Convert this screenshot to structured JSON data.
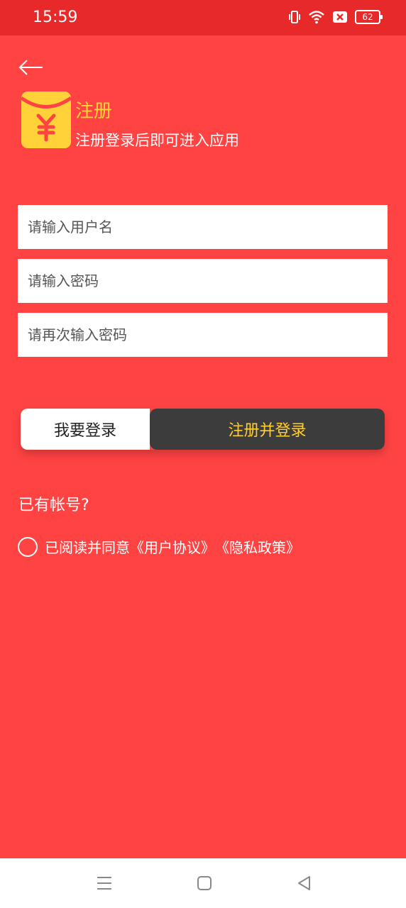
{
  "status": {
    "time": "15:59",
    "battery": "62"
  },
  "header": {
    "title": "注册",
    "subtitle": "注册登录后即可进入应用"
  },
  "form": {
    "username_placeholder": "请输入用户名",
    "password_placeholder": "请输入密码",
    "confirm_placeholder": "请再次输入密码"
  },
  "buttons": {
    "login": "我要登录",
    "register": "注册并登录"
  },
  "has_account": "已有帐号?",
  "agreement": {
    "prefix": "已阅读并同意",
    "user_agreement": "《用户协议》",
    "privacy_policy": "《隐私政策》"
  },
  "colors": {
    "background": "#ff4343",
    "statusbar": "#e8292a",
    "accent_yellow": "#ffd23a",
    "dark_button": "#3c3c3c"
  },
  "icons": [
    "vibrate-icon",
    "wifi-icon",
    "sim-off-icon",
    "battery-icon",
    "back-arrow-icon",
    "red-envelope-logo-icon",
    "menu-icon",
    "home-icon",
    "back-icon"
  ]
}
